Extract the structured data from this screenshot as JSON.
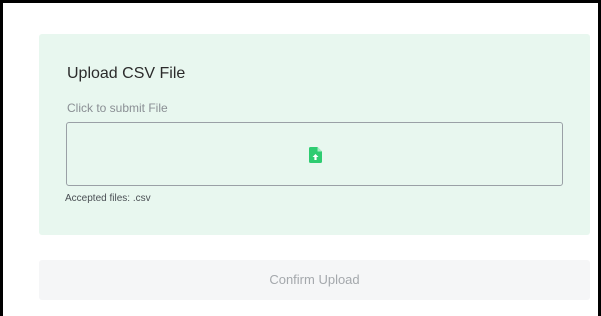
{
  "upload": {
    "title": "Upload CSV File",
    "hint": "Click to submit File",
    "accepted": "Accepted files: .csv",
    "dropzone_icon": "file-upload-icon"
  },
  "confirm_button": {
    "label": "Confirm Upload",
    "enabled": false
  },
  "colors": {
    "panel_background": "#e8f7ef",
    "icon_accent": "#2ecc71",
    "button_background": "#f5f6f7",
    "button_text": "#a4a8ac"
  }
}
